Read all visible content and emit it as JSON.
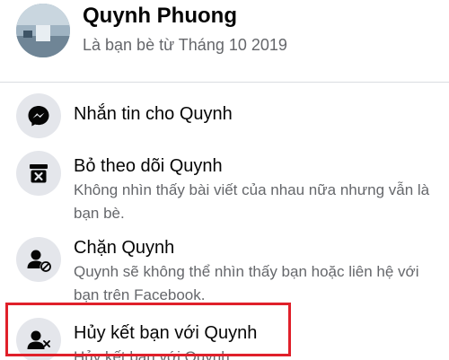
{
  "profile": {
    "name": "Quynh Phuong",
    "subtitle": "Là bạn bè từ Tháng 10 2019"
  },
  "menu": {
    "items": [
      {
        "title": "Nhắn tin cho Quynh",
        "icon": "messenger-icon"
      },
      {
        "title": "Bỏ theo dõi Quynh",
        "description": "Không nhìn thấy bài viết của nhau nữa nhưng vẫn là bạn bè.",
        "icon": "unfollow-box-icon"
      },
      {
        "title": "Chặn Quynh",
        "description": "Quynh sẽ không thể nhìn thấy bạn hoặc liên hệ với bạn trên Facebook.",
        "icon": "block-user-icon"
      },
      {
        "title": "Hủy kết bạn với Quynh",
        "description": "Hủy kết bạn với Quynh",
        "icon": "unfriend-user-icon"
      }
    ]
  },
  "colors": {
    "highlight": "#e0202a",
    "icon_background": "#e4e6eb",
    "title_text": "#050505",
    "secondary_text": "#65676b"
  }
}
